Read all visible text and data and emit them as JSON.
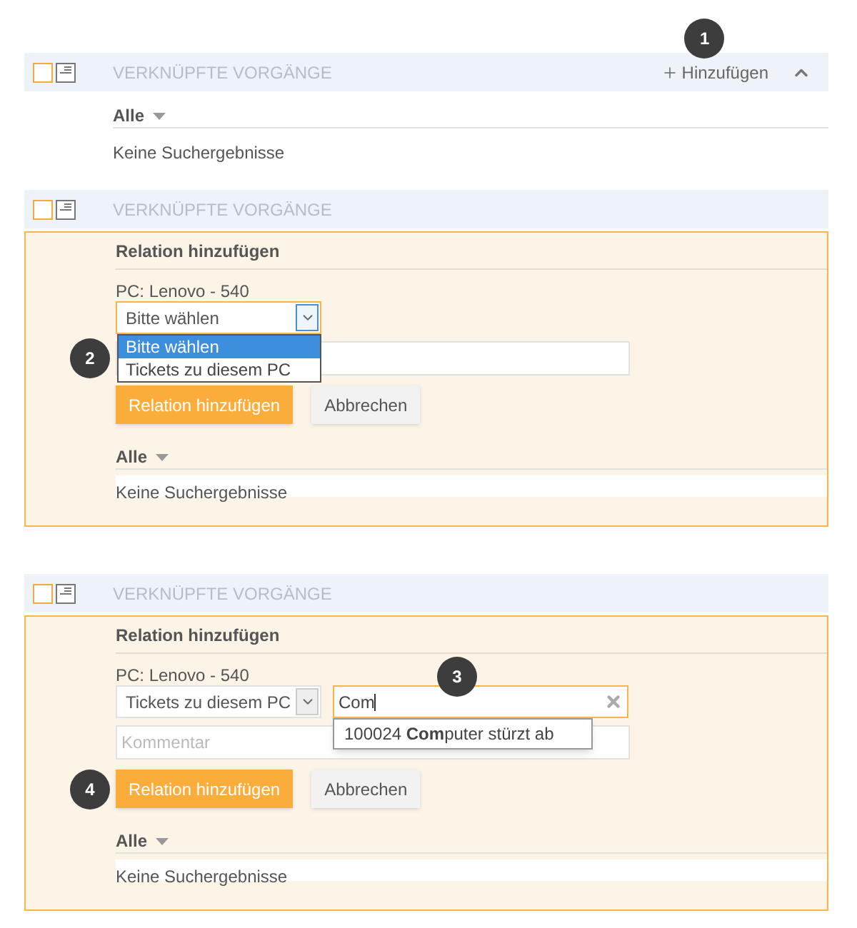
{
  "panels": [
    {
      "title": "VERKNÜPFTE VORGÄNGE",
      "add_label": "Hinzufügen",
      "add_badge": "1",
      "expanded": true,
      "filter": "Alle",
      "empty_text": "Keine Suchergebnisse"
    },
    {
      "title": "VERKNÜPFTE VORGÄNGE",
      "filter": "Alle",
      "empty_text": "Keine Suchergebnisse",
      "form": {
        "heading": "Relation hinzufügen",
        "subject": "PC: Lenovo - 540",
        "select": {
          "value": "Bitte wählen",
          "badge": "2",
          "focused": true,
          "expanded": true,
          "options": [
            {
              "label": "Bitte wählen",
              "selected": true
            },
            {
              "label": "Tickets zu diesem PC",
              "selected": false
            }
          ]
        },
        "submit": "Relation hinzufügen",
        "cancel": "Abbrechen"
      }
    },
    {
      "title": "VERKNÜPFTE VORGÄNGE",
      "filter": "Alle",
      "empty_text": "Keine Suchergebnisse",
      "form": {
        "heading": "Relation hinzufügen",
        "subject": "PC: Lenovo - 540",
        "select": {
          "value": "Tickets zu diesem PC",
          "focused": false,
          "expanded": false
        },
        "search": {
          "value": "Com",
          "badge": "3",
          "focused": true,
          "suggestions": [
            "100024 **Com**puter stürzt ab"
          ]
        },
        "comment": {
          "placeholder": "Kommentar"
        },
        "submit": "Relation hinzufügen",
        "submit_badge": "4",
        "cancel": "Abbrechen"
      }
    }
  ]
}
